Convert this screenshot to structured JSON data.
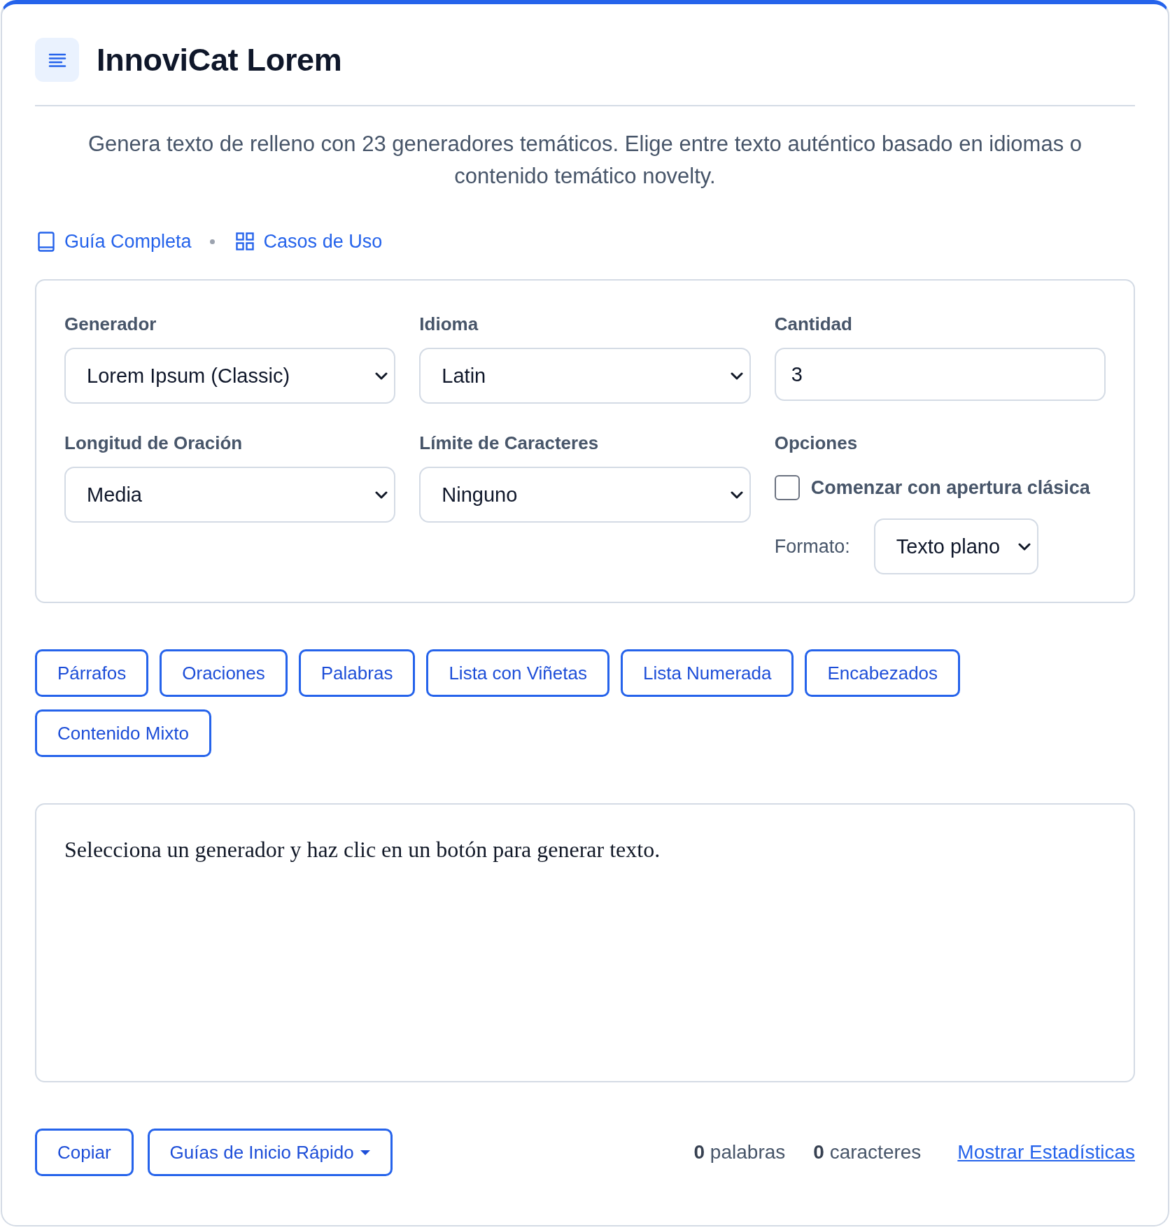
{
  "header": {
    "title": "InnoviCat Lorem"
  },
  "intro": {
    "description": "Genera texto de relleno con 23 generadores temáticos. Elige entre texto auténtico basado en idiomas o contenido temático novelty.",
    "links": [
      {
        "label": "Guía Completa",
        "kind": "book"
      },
      {
        "label": "Casos de Uso",
        "kind": "grid"
      }
    ]
  },
  "settings": {
    "fields": [
      {
        "label": "Generador",
        "kind": "select",
        "value": "Lorem Ipsum (Classic)"
      },
      {
        "label": "Idioma",
        "kind": "select",
        "value": "Latin"
      },
      {
        "label": "Cantidad",
        "kind": "input",
        "value": "3"
      },
      {
        "label": "Longitud de Oración",
        "kind": "select",
        "value": "Media"
      },
      {
        "label": "Límite de Caracteres",
        "kind": "select",
        "value": "Ninguno"
      },
      {
        "label": "Opciones",
        "kind": "options",
        "checkbox": {
          "label": "Comenzar con apertura clásica",
          "checked": false
        },
        "format": {
          "label": "Formato:",
          "value": "Texto plano"
        }
      }
    ]
  },
  "generate_buttons": [
    "Párrafos",
    "Oraciones",
    "Palabras",
    "Lista con Viñetas",
    "Lista Numerada",
    "Encabezados",
    "Contenido Mixto"
  ],
  "output": {
    "text": "Selecciona un generador y haz clic en un botón para generar texto."
  },
  "footer": {
    "buttons": [
      {
        "label": "Copiar",
        "kind": "button"
      },
      {
        "label": "Guías de Inicio Rápido",
        "kind": "dropdown"
      }
    ],
    "stats": [
      "**0** palabras",
      "**0** caracteres"
    ],
    "link": "Mostrar Estadísticas"
  }
}
